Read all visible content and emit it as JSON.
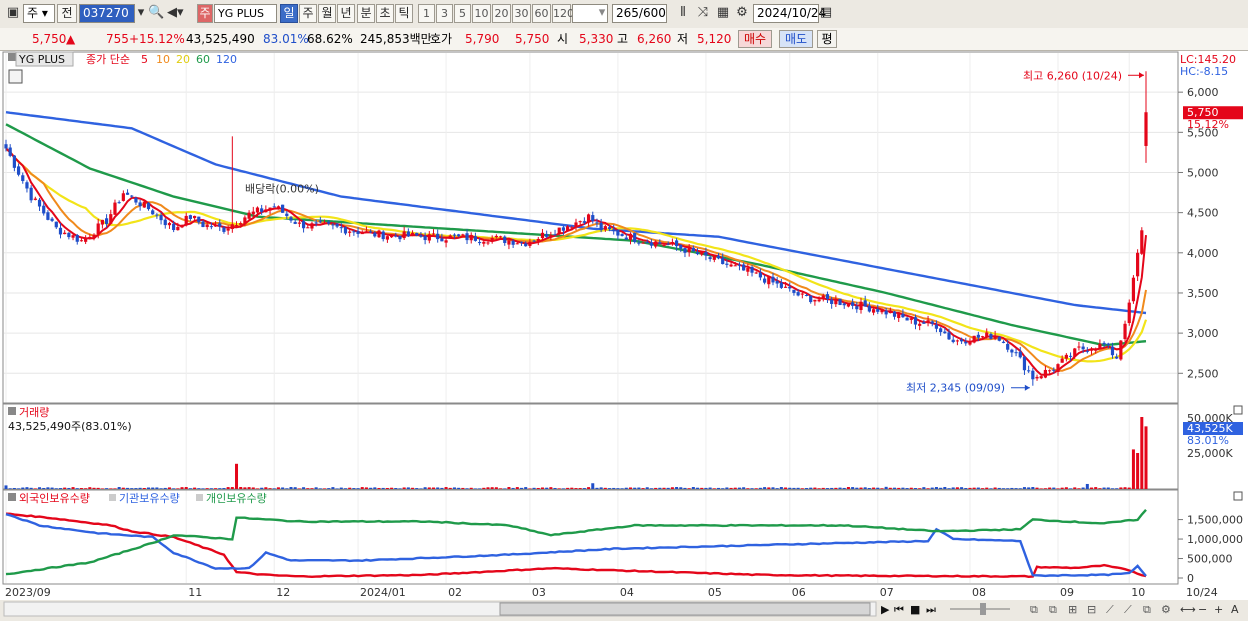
{
  "toolbar": {
    "market": "주",
    "prev_label": "전",
    "stock_code": "037270",
    "stock_name": "YG PLUS",
    "stock_prefix": "주",
    "periods": [
      "일",
      "주",
      "월",
      "년",
      "분",
      "초",
      "틱"
    ],
    "selected_period": "일",
    "intervals": [
      "1",
      "3",
      "5",
      "10",
      "20",
      "30",
      "60",
      "120"
    ],
    "count": "265",
    "count_total": "/600",
    "date": "2024/10/24"
  },
  "quote": {
    "price": "5,750",
    "change": "755",
    "change_pct": "+15.12%",
    "volume": "43,525,490",
    "vol_ratio": "83.01%",
    "turnover": "68.62%",
    "amount": "245,853백만",
    "ask_label": "호가",
    "ask1": "5,790",
    "ask2": "5,750",
    "open_label": "시",
    "open": "5,330",
    "high_label": "고",
    "high": "6,260",
    "low_label": "저",
    "low": "5,120",
    "buy_label": "매수",
    "sell_label": "매도",
    "avg_label": "평"
  },
  "colors": {
    "up": "#e4061a",
    "down": "#1f4ec9",
    "ma5": "#e4061a",
    "ma10": "#f08a1c",
    "ma20": "#f2e419",
    "ma60": "#1f9a4a",
    "ma120": "#2f62e0",
    "foreign": "#e4061a",
    "inst": "#2f62e0",
    "indiv": "#1f9a4a"
  },
  "chart_data": [
    {
      "type": "candlestick",
      "title": "YG PLUS",
      "legend": [
        "종가 단순",
        "5",
        "10",
        "20",
        "60",
        "120"
      ],
      "corner_labels": [
        "LC:145.20",
        "HC:-8.15"
      ],
      "y_ticks": [
        2500,
        3000,
        3500,
        4000,
        4500,
        5000,
        5500,
        6000
      ],
      "ylim": [
        2130,
        6500
      ],
      "anchors_close": [
        [
          0,
          5300
        ],
        [
          6,
          4700
        ],
        [
          12,
          4300
        ],
        [
          18,
          4150
        ],
        [
          24,
          4400
        ],
        [
          28,
          4750
        ],
        [
          34,
          4550
        ],
        [
          40,
          4300
        ],
        [
          44,
          4450
        ],
        [
          47,
          4350
        ],
        [
          52,
          4300
        ],
        [
          58,
          4480
        ],
        [
          64,
          4580
        ],
        [
          70,
          4350
        ],
        [
          78,
          4320
        ],
        [
          88,
          4230
        ],
        [
          100,
          4200
        ],
        [
          116,
          4180
        ],
        [
          124,
          4130
        ],
        [
          130,
          4260
        ],
        [
          136,
          4380
        ],
        [
          139,
          4450
        ],
        [
          142,
          4300
        ],
        [
          150,
          4180
        ],
        [
          160,
          4080
        ],
        [
          172,
          3850
        ],
        [
          180,
          3700
        ],
        [
          190,
          3450
        ],
        [
          200,
          3380
        ],
        [
          208,
          3300
        ],
        [
          216,
          3150
        ],
        [
          222,
          3100
        ],
        [
          226,
          2900
        ],
        [
          236,
          2980
        ],
        [
          240,
          2800
        ],
        [
          245,
          2450
        ],
        [
          250,
          2560
        ],
        [
          256,
          2800
        ],
        [
          262,
          2850
        ],
        [
          265,
          2700
        ],
        [
          268,
          3380
        ],
        [
          270,
          4000
        ],
        [
          271,
          4280
        ],
        [
          272,
          5750
        ]
      ],
      "ma120_anchors": [
        [
          0,
          5750
        ],
        [
          30,
          5550
        ],
        [
          50,
          5100
        ],
        [
          80,
          4700
        ],
        [
          110,
          4500
        ],
        [
          140,
          4300
        ],
        [
          170,
          4200
        ],
        [
          200,
          3900
        ],
        [
          230,
          3600
        ],
        [
          255,
          3350
        ],
        [
          272,
          3250
        ]
      ],
      "ma60_anchors": [
        [
          0,
          5600
        ],
        [
          20,
          5050
        ],
        [
          40,
          4700
        ],
        [
          60,
          4450
        ],
        [
          90,
          4350
        ],
        [
          120,
          4250
        ],
        [
          150,
          4150
        ],
        [
          180,
          3850
        ],
        [
          210,
          3500
        ],
        [
          240,
          3100
        ],
        [
          262,
          2850
        ],
        [
          272,
          2900
        ]
      ],
      "current_price_label": "5,750",
      "current_pct_label": "15.12%",
      "high_annotation": "최고 6,260 (10/24)",
      "low_annotation": "최저 2,345 (09/09)",
      "dividend_label": "배당락(0.00%)",
      "x_labels": [
        "2023/09",
        "11",
        "12",
        "2024/01",
        "02",
        "03",
        "04",
        "05",
        "06",
        "07",
        "08",
        "09",
        "10",
        "10/24"
      ]
    },
    {
      "type": "bar",
      "title": "거래량",
      "value_label": "43,525,490주(83.01%)",
      "y_ticks": [
        "50,000K",
        "25,000K"
      ],
      "current_label": "43,525K",
      "current_pct_label": "83.01%",
      "spikes": [
        [
          0,
          0.05
        ],
        [
          55,
          0.35
        ],
        [
          140,
          0.08
        ],
        [
          210,
          0.03
        ],
        [
          258,
          0.07
        ],
        [
          269,
          0.55
        ],
        [
          270,
          0.5
        ],
        [
          271,
          1.0
        ],
        [
          272,
          0.87
        ]
      ]
    },
    {
      "type": "line",
      "series": [
        {
          "name": "외국인보유수량",
          "anchors": [
            [
              0,
              1650000
            ],
            [
              10,
              1550000
            ],
            [
              25,
              1350000
            ],
            [
              30,
              1200000
            ],
            [
              40,
              1050000
            ],
            [
              52,
              600000
            ],
            [
              55,
              150000
            ],
            [
              62,
              80000
            ],
            [
              70,
              40000
            ],
            [
              100,
              80000
            ],
            [
              130,
              250000
            ],
            [
              150,
              180000
            ],
            [
              180,
              80000
            ],
            [
              200,
              60000
            ],
            [
              245,
              40000
            ],
            [
              246,
              280000
            ],
            [
              255,
              260000
            ],
            [
              262,
              320000
            ],
            [
              268,
              200000
            ],
            [
              272,
              40000
            ]
          ]
        },
        {
          "name": "기관보유수량",
          "anchors": [
            [
              0,
              1650000
            ],
            [
              8,
              1350000
            ],
            [
              22,
              1150000
            ],
            [
              35,
              1050000
            ],
            [
              40,
              650000
            ],
            [
              50,
              250000
            ],
            [
              58,
              250000
            ],
            [
              62,
              650000
            ],
            [
              68,
              450000
            ],
            [
              85,
              450000
            ],
            [
              120,
              600000
            ],
            [
              145,
              750000
            ],
            [
              200,
              900000
            ],
            [
              220,
              950000
            ],
            [
              222,
              1250000
            ],
            [
              226,
              1000000
            ],
            [
              242,
              950000
            ],
            [
              245,
              60000
            ],
            [
              262,
              80000
            ],
            [
              268,
              120000
            ],
            [
              270,
              300000
            ],
            [
              272,
              60000
            ]
          ]
        },
        {
          "name": "개인보유수량",
          "anchors": [
            [
              0,
              100000
            ],
            [
              20,
              400000
            ],
            [
              35,
              900000
            ],
            [
              40,
              1100000
            ],
            [
              54,
              1000000
            ],
            [
              55,
              1550000
            ],
            [
              70,
              1450000
            ],
            [
              100,
              1450000
            ],
            [
              120,
              1350000
            ],
            [
              130,
              1100000
            ],
            [
              150,
              1350000
            ],
            [
              200,
              1350000
            ],
            [
              222,
              1200000
            ],
            [
              242,
              1250000
            ],
            [
              245,
              1500000
            ],
            [
              262,
              1400000
            ],
            [
              270,
              1500000
            ],
            [
              272,
              1750000
            ]
          ]
        }
      ],
      "y_ticks": [
        "1,500,000",
        "1,000,000",
        "500,000",
        "0"
      ]
    }
  ]
}
